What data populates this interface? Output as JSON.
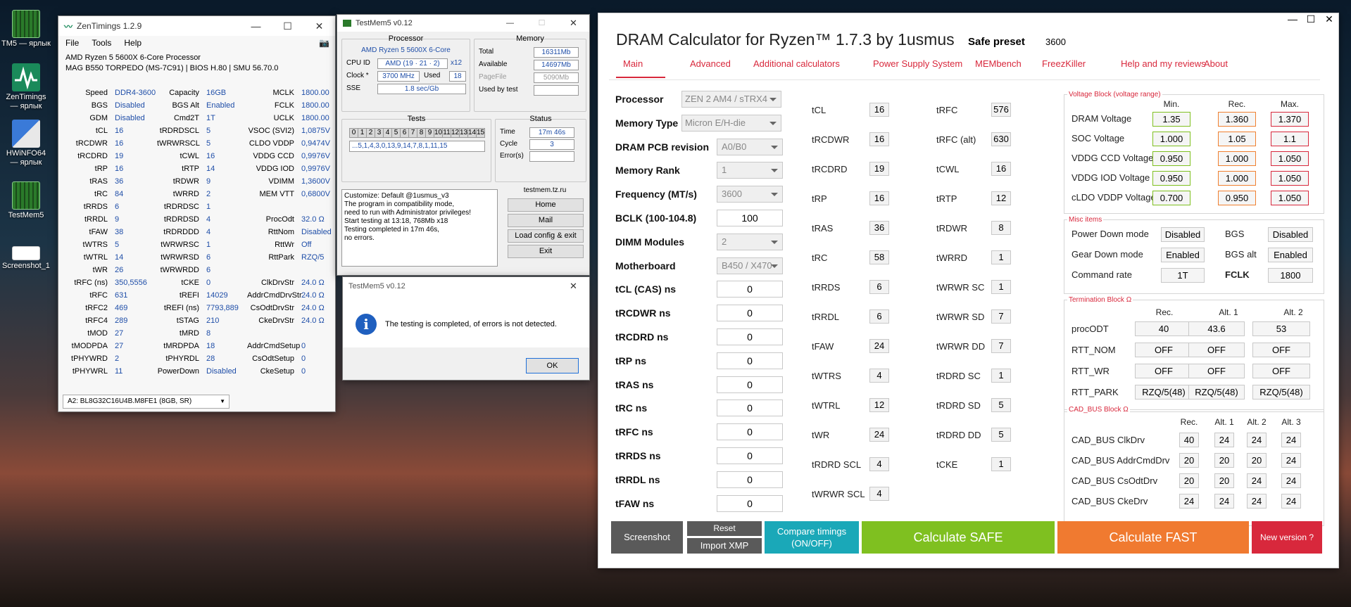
{
  "desktop": {
    "icons": [
      {
        "label": "TM5 — ярлык",
        "icon": "testmem-icon"
      },
      {
        "label": "ZenTimings — ярлык",
        "icon": "zentimings-icon"
      },
      {
        "label": "HWiNFO64 — ярлык",
        "icon": "hwinfo-icon"
      },
      {
        "label": "TestMem5",
        "icon": "testmem-icon"
      },
      {
        "label": "Screenshot_1",
        "icon": "image-icon"
      }
    ]
  },
  "zentimings": {
    "title": "ZenTimings 1.2.9",
    "menu": [
      "File",
      "Tools",
      "Help"
    ],
    "cpu": "AMD Ryzen 5 5600X 6-Core Processor",
    "board": "MAG B550 TORPEDO (MS-7C91) | BIOS H.80 | SMU 56.70.0",
    "rows": [
      [
        [
          "Speed",
          "DDR4-3600"
        ],
        [
          "Capacity",
          "16GB"
        ],
        [
          "MCLK",
          "1800.00"
        ]
      ],
      [
        [
          "BGS",
          "Disabled"
        ],
        [
          "BGS Alt",
          "Enabled"
        ],
        [
          "FCLK",
          "1800.00"
        ]
      ],
      [
        [
          "GDM",
          "Disabled"
        ],
        [
          "Cmd2T",
          "1T"
        ],
        [
          "UCLK",
          "1800.00"
        ]
      ],
      [
        [
          "tCL",
          "16"
        ],
        [
          "tRDRDSCL",
          "5"
        ],
        [
          "VSOC (SVI2)",
          "1,0875V"
        ]
      ],
      [
        [
          "tRCDWR",
          "16"
        ],
        [
          "tWRWRSCL",
          "5"
        ],
        [
          "CLDO VDDP",
          "0,9474V"
        ]
      ],
      [
        [
          "tRCDRD",
          "19"
        ],
        [
          "tCWL",
          "16"
        ],
        [
          "VDDG CCD",
          "0,9976V"
        ]
      ],
      [
        [
          "tRP",
          "16"
        ],
        [
          "tRTP",
          "14"
        ],
        [
          "VDDG IOD",
          "0,9976V"
        ]
      ],
      [
        [
          "tRAS",
          "36"
        ],
        [
          "tRDWR",
          "9"
        ],
        [
          "VDIMM",
          "1,3600V"
        ]
      ],
      [
        [
          "tRC",
          "84"
        ],
        [
          "tWRRD",
          "2"
        ],
        [
          "MEM VTT",
          "0,6800V"
        ]
      ],
      [
        [
          "tRRDS",
          "6"
        ],
        [
          "tRDRDSC",
          "1"
        ],
        [
          "",
          ""
        ]
      ],
      [
        [
          "tRRDL",
          "9"
        ],
        [
          "tRDRDSD",
          "4"
        ],
        [
          "ProcOdt",
          "32.0 Ω"
        ]
      ],
      [
        [
          "tFAW",
          "38"
        ],
        [
          "tRDRDDD",
          "4"
        ],
        [
          "RttNom",
          "Disabled"
        ]
      ],
      [
        [
          "tWTRS",
          "5"
        ],
        [
          "tWRWRSC",
          "1"
        ],
        [
          "RttWr",
          "Off"
        ]
      ],
      [
        [
          "tWTRL",
          "14"
        ],
        [
          "tWRWRSD",
          "6"
        ],
        [
          "RttPark",
          "RZQ/5"
        ]
      ],
      [
        [
          "tWR",
          "26"
        ],
        [
          "tWRWRDD",
          "6"
        ],
        [
          "",
          ""
        ]
      ],
      [
        [
          "tRFC (ns)",
          "350,5556"
        ],
        [
          "tCKE",
          "0"
        ],
        [
          "ClkDrvStr",
          "24.0 Ω"
        ]
      ],
      [
        [
          "tRFC",
          "631"
        ],
        [
          "tREFI",
          "14029"
        ],
        [
          "AddrCmdDrvStr",
          "24.0 Ω"
        ]
      ],
      [
        [
          "tRFC2",
          "469"
        ],
        [
          "tREFI (ns)",
          "7793,889"
        ],
        [
          "CsOdtDrvStr",
          "24.0 Ω"
        ]
      ],
      [
        [
          "tRFC4",
          "289"
        ],
        [
          "tSTAG",
          "210"
        ],
        [
          "CkeDrvStr",
          "24.0 Ω"
        ]
      ],
      [
        [
          "tMOD",
          "27"
        ],
        [
          "tMRD",
          "8"
        ],
        [
          "",
          ""
        ]
      ],
      [
        [
          "tMODPDA",
          "27"
        ],
        [
          "tMRDPDA",
          "18"
        ],
        [
          "AddrCmdSetup",
          "0"
        ]
      ],
      [
        [
          "tPHYWRD",
          "2"
        ],
        [
          "tPHYRDL",
          "28"
        ],
        [
          "CsOdtSetup",
          "0"
        ]
      ],
      [
        [
          "tPHYWRL",
          "11"
        ],
        [
          "PowerDown",
          "Disabled"
        ],
        [
          "CkeSetup",
          "0"
        ]
      ]
    ],
    "dimm": "A2: BL8G32C16U4B.M8FE1 (8GB, SR)"
  },
  "testmem": {
    "title": "TestMem5 v0.12",
    "processor_label": "Processor",
    "processor": "AMD Ryzen 5 5600X 6-Core",
    "cpuid_label": "CPU ID",
    "cpuid": "AMD  (19 · 21 · 2)",
    "cpuid_x": "x12",
    "clock_label": "Clock *",
    "clock": "3700 MHz",
    "used_label": "Used",
    "used": "18",
    "sse_label": "SSE",
    "sse": "1.8 sec/Gb",
    "memory_label": "Memory",
    "total_label": "Total",
    "total": "16311Mb",
    "available_label": "Available",
    "available": "14697Mb",
    "pagefile_label": "PageFile",
    "pagefile": "5090Mb",
    "usedby_label": "Used by test",
    "tests_label": "Tests",
    "test_nums": [
      "0",
      "1",
      "2",
      "3",
      "4",
      "5",
      "6",
      "7",
      "8",
      "9",
      "10",
      "11",
      "12",
      "13",
      "14",
      "15"
    ],
    "sequence": "...5,1,4,3,0,13,9,14,7,8,1,11,15",
    "status_label": "Status",
    "time_label": "Time",
    "time": "17m 46s",
    "cycle_label": "Cycle",
    "cycle": "3",
    "errors_label": "Error(s)",
    "log": [
      "Customize: Default @1usmus_v3",
      "The program in compatibility mode,",
      "need to run with Administrator privileges!",
      "Start testing at 13:18, 768Mb x18",
      "Testing completed in 17m 46s,",
      "no errors."
    ],
    "site": "testmem.tz.ru",
    "buttons": [
      "Home",
      "Mail",
      "Load config & exit",
      "Exit"
    ]
  },
  "dialog": {
    "title": "TestMem5 v0.12",
    "message": "The testing is completed, of errors is not detected.",
    "ok": "OK"
  },
  "dram": {
    "title": "DRAM Calculator for Ryzen™ 1.7.3 by 1usmus",
    "preset_label": "Safe preset",
    "preset_value": "3600",
    "tabs": [
      "Main",
      "Advanced",
      "Additional calculators",
      "Power Supply System",
      "MEMbench",
      "FreezKiller",
      "Help and my reviews",
      "About"
    ],
    "left": [
      {
        "label": "Processor",
        "value": "ZEN 2 AM4 / sTRX4",
        "type": "select"
      },
      {
        "label": "Memory Type",
        "value": "Micron E/H-die",
        "type": "select"
      },
      {
        "label": "DRAM PCB revision",
        "value": "A0/B0",
        "type": "select"
      },
      {
        "label": "Memory Rank",
        "value": "1",
        "type": "select"
      },
      {
        "label": "Frequency (MT/s)",
        "value": "3600",
        "type": "select"
      },
      {
        "label": "BCLK (100-104.8)",
        "value": "100",
        "type": "input"
      },
      {
        "label": "DIMM Modules",
        "value": "2",
        "type": "select"
      },
      {
        "label": "Motherboard",
        "value": "B450 / X470",
        "type": "select"
      },
      {
        "label": "tCL (CAS) ns",
        "value": "0",
        "type": "input"
      },
      {
        "label": "tRCDWR ns",
        "value": "0",
        "type": "input"
      },
      {
        "label": "tRCDRD ns",
        "value": "0",
        "type": "input"
      },
      {
        "label": "tRP ns",
        "value": "0",
        "type": "input"
      },
      {
        "label": "tRAS ns",
        "value": "0",
        "type": "input"
      },
      {
        "label": "tRC ns",
        "value": "0",
        "type": "input"
      },
      {
        "label": "tRFC ns",
        "value": "0",
        "type": "input"
      },
      {
        "label": "tRRDS ns",
        "value": "0",
        "type": "input"
      },
      {
        "label": "tRRDL ns",
        "value": "0",
        "type": "input"
      },
      {
        "label": "tFAW ns",
        "value": "0",
        "type": "input"
      }
    ],
    "timings1": [
      [
        "tCL",
        "16"
      ],
      [
        "tRCDWR",
        "16"
      ],
      [
        "tRCDRD",
        "19"
      ],
      [
        "tRP",
        "16"
      ],
      [
        "tRAS",
        "36"
      ],
      [
        "tRC",
        "58"
      ],
      [
        "tRRDS",
        "6"
      ],
      [
        "tRRDL",
        "6"
      ],
      [
        "tFAW",
        "24"
      ],
      [
        "tWTRS",
        "4"
      ],
      [
        "tWTRL",
        "12"
      ],
      [
        "tWR",
        "24"
      ],
      [
        "tRDRD SCL",
        "4"
      ],
      [
        "tWRWR SCL",
        "4"
      ]
    ],
    "timings2": [
      [
        "tRFC",
        "576"
      ],
      [
        "tRFC (alt)",
        "630"
      ],
      [
        "tCWL",
        "16"
      ],
      [
        "tRTP",
        "12"
      ],
      [
        "tRDWR",
        "8"
      ],
      [
        "tWRRD",
        "1"
      ],
      [
        "tWRWR SC",
        "1"
      ],
      [
        "tWRWR SD",
        "7"
      ],
      [
        "tWRWR DD",
        "7"
      ],
      [
        "tRDRD SC",
        "1"
      ],
      [
        "tRDRD SD",
        "5"
      ],
      [
        "tRDRD DD",
        "5"
      ],
      [
        "tCKE",
        "1"
      ]
    ],
    "voltage": {
      "title": "Voltage Block (voltage range)",
      "headers": [
        "Min.",
        "Rec.",
        "Max."
      ],
      "rows": [
        [
          "DRAM Voltage",
          "1.35",
          "1.360",
          "1.370"
        ],
        [
          "SOC Voltage",
          "1.000",
          "1.05",
          "1.1"
        ],
        [
          "VDDG  CCD Voltage",
          "0.950",
          "1.000",
          "1.050"
        ],
        [
          "VDDG  IOD Voltage",
          "0.950",
          "1.000",
          "1.050"
        ],
        [
          "cLDO VDDP Voltage",
          "0.700",
          "0.950",
          "1.050"
        ]
      ]
    },
    "misc": {
      "title": "Misc items",
      "rows": [
        [
          "Power Down mode",
          "Disabled",
          "BGS",
          "Disabled"
        ],
        [
          "Gear Down mode",
          "Enabled",
          "BGS alt",
          "Enabled"
        ],
        [
          "Command rate",
          "1T",
          "FCLK",
          "1800"
        ]
      ]
    },
    "term": {
      "title": "Termination Block Ω",
      "headers": [
        "Rec.",
        "Alt. 1",
        "Alt. 2"
      ],
      "rows": [
        [
          "procODT",
          "40",
          "43.6",
          "53"
        ],
        [
          "RTT_NOM",
          "OFF",
          "OFF",
          "OFF"
        ],
        [
          "RTT_WR",
          "OFF",
          "OFF",
          "OFF"
        ],
        [
          "RTT_PARK",
          "RZQ/5(48)",
          "RZQ/5(48)",
          "RZQ/5(48)"
        ]
      ]
    },
    "cad": {
      "title": "CAD_BUS Block Ω",
      "headers": [
        "Rec.",
        "Alt. 1",
        "Alt. 2",
        "Alt. 3"
      ],
      "rows": [
        [
          "CAD_BUS ClkDrv",
          "40",
          "24",
          "24",
          "24"
        ],
        [
          "CAD_BUS AddrCmdDrv",
          "20",
          "20",
          "20",
          "24"
        ],
        [
          "CAD_BUS CsOdtDrv",
          "20",
          "20",
          "24",
          "24"
        ],
        [
          "CAD_BUS CkeDrv",
          "24",
          "24",
          "24",
          "24"
        ]
      ]
    },
    "buttons": {
      "screenshot": "Screenshot",
      "reset": "Reset",
      "import": "Import XMP",
      "compare": "Compare timings (ON/OFF)",
      "safe": "Calculate SAFE",
      "fast": "Calculate FAST",
      "newver": "New version ?"
    },
    "colors": {
      "accent": "#d8283c",
      "green": "#7fc020",
      "orange": "#f07a30",
      "teal": "#1aa8b8",
      "dark": "#5a5a5a"
    }
  }
}
